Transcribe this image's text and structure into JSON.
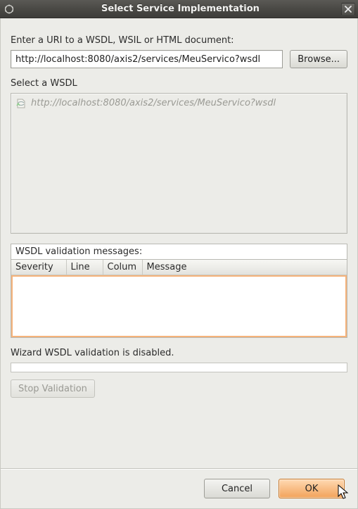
{
  "window": {
    "title": "Select Service Implementation"
  },
  "uri": {
    "label": "Enter a URI to a WSDL, WSIL or HTML document:",
    "value": "http://localhost:8080/axis2/services/MeuServico?wsdl",
    "browse_label": "Browse..."
  },
  "wsdl": {
    "label": "Select a WSDL",
    "items": [
      {
        "text": "http://localhost:8080/axis2/services/MeuServico?wsdl"
      }
    ]
  },
  "validation": {
    "section_label": "WSDL validation messages:",
    "columns": {
      "severity": "Severity",
      "line": "Line",
      "column": "Colum",
      "message": "Message"
    },
    "status": "Wizard WSDL validation is disabled.",
    "stop_label": "Stop Validation"
  },
  "footer": {
    "cancel_label": "Cancel",
    "ok_label": "OK"
  }
}
